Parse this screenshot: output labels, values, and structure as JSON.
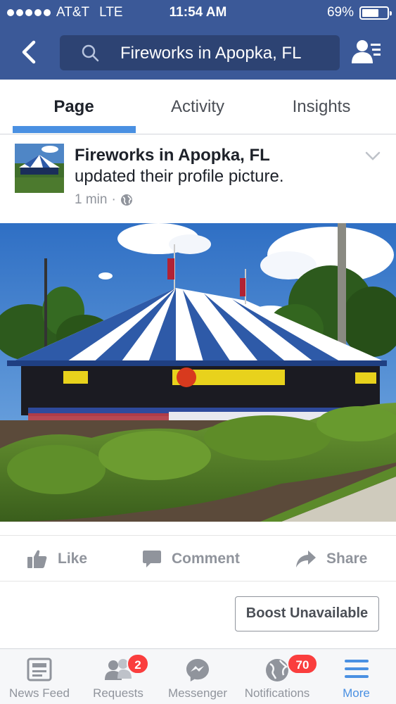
{
  "status_bar": {
    "carrier": "AT&T",
    "network": "LTE",
    "time": "11:54 AM",
    "battery": "69%",
    "battery_level": 0.69
  },
  "header": {
    "search_text": "Fireworks in Apopka, FL"
  },
  "tabs": [
    {
      "label": "Page",
      "active": true
    },
    {
      "label": "Activity",
      "active": false
    },
    {
      "label": "Insights",
      "active": false
    }
  ],
  "post": {
    "page_name": "Fireworks in Apopka, FL",
    "action": "updated their profile picture.",
    "time": "1 min",
    "separator": "·",
    "actions": {
      "like": "Like",
      "comment": "Comment",
      "share": "Share"
    },
    "boost_label": "Boost Unavailable"
  },
  "tabbar": [
    {
      "label": "News Feed",
      "icon": "news-feed-icon"
    },
    {
      "label": "Requests",
      "icon": "friend-requests-icon",
      "badge": "2"
    },
    {
      "label": "Messenger",
      "icon": "messenger-icon"
    },
    {
      "label": "Notifications",
      "icon": "globe-icon",
      "badge": "70"
    },
    {
      "label": "More",
      "icon": "menu-icon",
      "active": true
    }
  ],
  "colors": {
    "header_bg": "#3b5998",
    "accent": "#4a90e2",
    "badge": "#fa3e3e"
  }
}
